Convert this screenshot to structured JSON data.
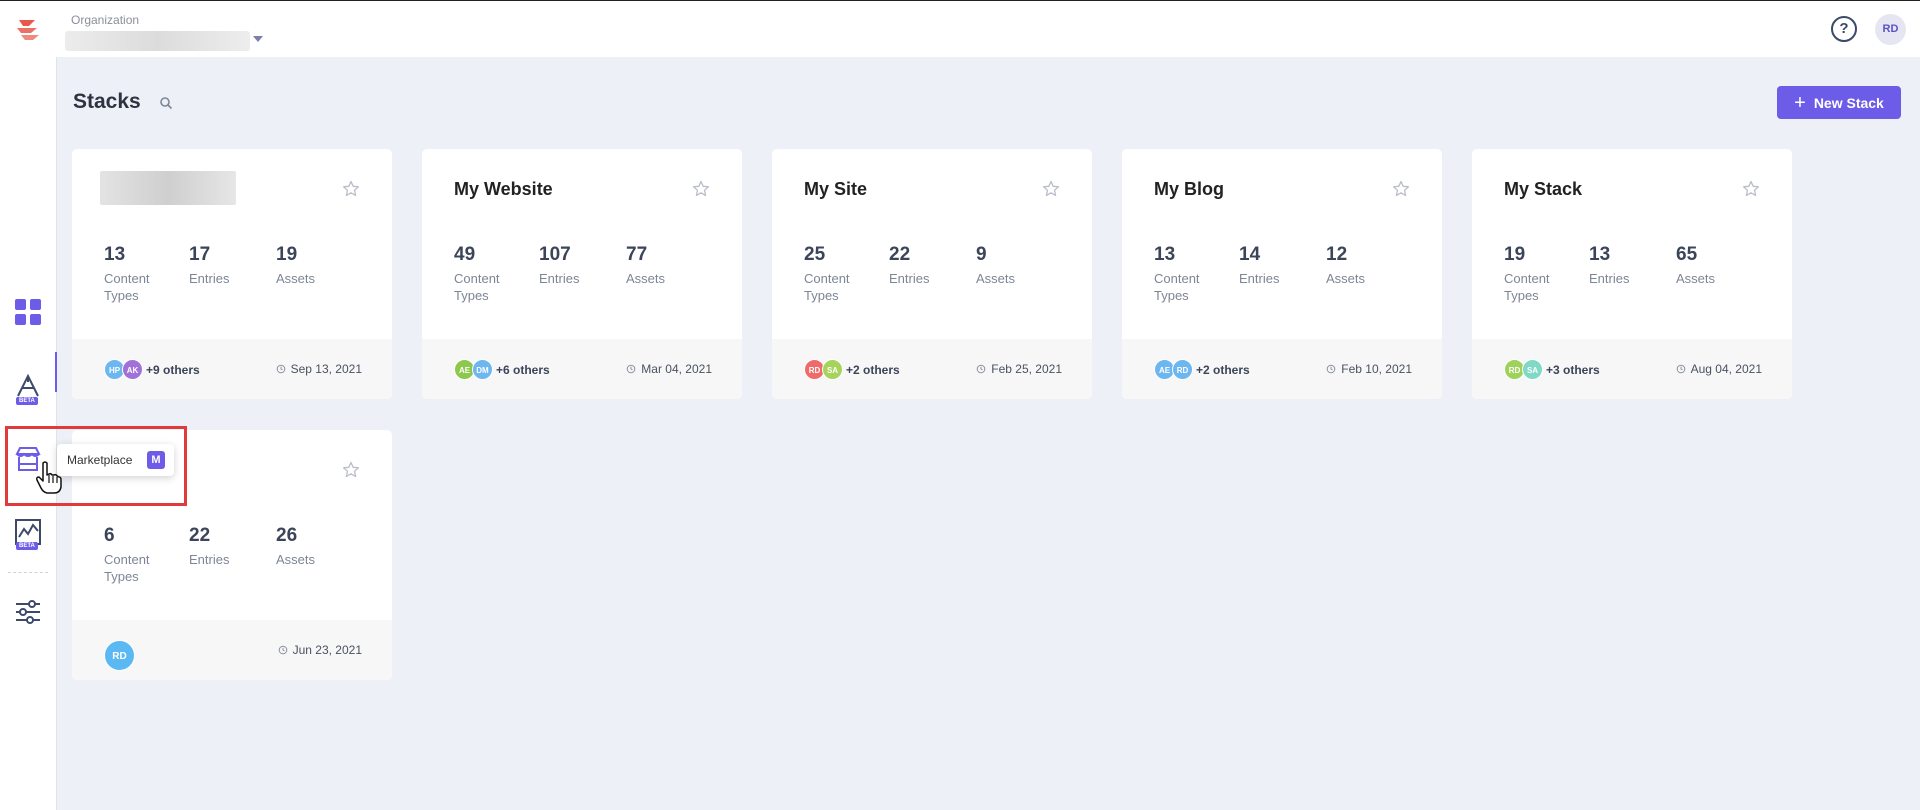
{
  "header": {
    "org_label": "Organization",
    "help_label": "?",
    "user_initials": "RD"
  },
  "sidebar": {
    "items": [
      {
        "name": "dashboard",
        "icon": "grid-icon"
      },
      {
        "name": "automation",
        "icon": "automate-icon",
        "badge": "BETA"
      },
      {
        "name": "marketplace",
        "icon": "marketplace-icon"
      },
      {
        "name": "analytics",
        "icon": "analytics-icon",
        "badge": "BETA"
      },
      {
        "name": "settings",
        "icon": "sliders-icon"
      }
    ],
    "tooltip": {
      "label": "Marketplace",
      "shortcut": "M"
    }
  },
  "main": {
    "title": "Stacks",
    "new_stack_label": "New Stack",
    "stat_labels": {
      "content_types": "Content Types",
      "entries": "Entries",
      "assets": "Assets"
    },
    "stacks": [
      {
        "title": "",
        "content_types": "13",
        "entries": "17",
        "assets": "19",
        "avatars": [
          {
            "initials": "HP",
            "color": "#6cb7f0"
          },
          {
            "initials": "AK",
            "color": "#a072d9"
          }
        ],
        "others": "+9 others",
        "date": "Sep 13, 2021"
      },
      {
        "title": "My Website",
        "content_types": "49",
        "entries": "107",
        "assets": "77",
        "avatars": [
          {
            "initials": "AE",
            "color": "#8cc84b"
          },
          {
            "initials": "DM",
            "color": "#6cb7f0"
          }
        ],
        "others": "+6 others",
        "date": "Mar 04, 2021"
      },
      {
        "title": "My Site",
        "content_types": "25",
        "entries": "22",
        "assets": "9",
        "avatars": [
          {
            "initials": "RD",
            "color": "#ef6b6b"
          },
          {
            "initials": "SA",
            "color": "#a6d45a"
          }
        ],
        "others": "+2 others",
        "date": "Feb 25, 2021"
      },
      {
        "title": "My Blog",
        "content_types": "13",
        "entries": "14",
        "assets": "12",
        "avatars": [
          {
            "initials": "AE",
            "color": "#6cb7f0"
          },
          {
            "initials": "RD",
            "color": "#6cb7f0"
          }
        ],
        "others": "+2 others",
        "date": "Feb 10, 2021"
      },
      {
        "title": "My Stack",
        "content_types": "19",
        "entries": "13",
        "assets": "65",
        "avatars": [
          {
            "initials": "RD",
            "color": "#9ed25a"
          },
          {
            "initials": "SA",
            "color": "#7fd9c4"
          }
        ],
        "others": "+3 others",
        "date": "Aug 04, 2021"
      },
      {
        "title": "",
        "content_types": "6",
        "entries": "22",
        "assets": "26",
        "avatars": [
          {
            "initials": "RD",
            "color": "#5ab8f2"
          }
        ],
        "others": "",
        "date": "Jun 23, 2021"
      }
    ]
  },
  "colors": {
    "accent": "#6c5ce7",
    "highlight": "#e03a3a",
    "page_bg": "#edf0f7"
  }
}
